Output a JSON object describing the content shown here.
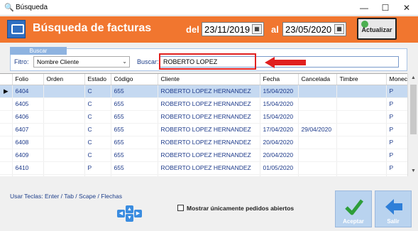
{
  "window": {
    "title": "Búsqueda",
    "controls": [
      "—",
      "☐",
      "✕"
    ]
  },
  "header": {
    "title": "Búsqueda de facturas",
    "del_label": "del",
    "date_from": "23/11/2019",
    "al_label": "al",
    "date_to": "23/05/2020",
    "refresh_label": "Actualizar",
    "accent_color": "#f1762f"
  },
  "search": {
    "group_caption": "Buscar",
    "filtro_label": "Fitro:",
    "filtro_value": "Nombre Cliente",
    "buscar_label": "Buscar:",
    "buscar_value": "ROBERTO LOPEZ"
  },
  "table": {
    "columns": [
      "Folio",
      "Orden",
      "Estado",
      "Código",
      "Cliente",
      "Fecha",
      "Cancelada",
      "Timbre",
      "Monec"
    ],
    "rows": [
      {
        "indicator": "▶",
        "cells": [
          "6404",
          "",
          "C",
          "655",
          "ROBERTO LOPEZ HERNANDEZ",
          "15/04/2020",
          "",
          "",
          "P"
        ]
      },
      {
        "indicator": "",
        "cells": [
          "6405",
          "",
          "C",
          "655",
          "ROBERTO LOPEZ HERNANDEZ",
          "15/04/2020",
          "",
          "",
          "P"
        ]
      },
      {
        "indicator": "",
        "cells": [
          "6406",
          "",
          "C",
          "655",
          "ROBERTO LOPEZ HERNANDEZ",
          "15/04/2020",
          "",
          "",
          "P"
        ]
      },
      {
        "indicator": "",
        "cells": [
          "6407",
          "",
          "C",
          "655",
          "ROBERTO LOPEZ HERNANDEZ",
          "17/04/2020",
          "29/04/2020",
          "",
          "P"
        ]
      },
      {
        "indicator": "",
        "cells": [
          "6408",
          "",
          "C",
          "655",
          "ROBERTO LOPEZ HERNANDEZ",
          "20/04/2020",
          "",
          "",
          "P"
        ]
      },
      {
        "indicator": "",
        "cells": [
          "6409",
          "",
          "C",
          "655",
          "ROBERTO LOPEZ HERNANDEZ",
          "20/04/2020",
          "",
          "",
          "P"
        ]
      },
      {
        "indicator": "",
        "cells": [
          "6410",
          "",
          "P",
          "655",
          "ROBERTO LOPEZ HERNANDEZ",
          "01/05/2020",
          "",
          "",
          "P"
        ]
      },
      {
        "indicator": "",
        "cells": [
          "6411",
          "",
          "C",
          "655",
          "ROBERTO LOPEZ HERNANDEZ",
          "04/05/2020",
          "",
          "CCAC7BDF-7...",
          "P"
        ]
      }
    ]
  },
  "footer": {
    "keys_text": "Usar Teclas:  Enter  /  Tab  /  Scape  /  Flechas",
    "checkbox_label": "Mostrar únicamente pedidos abiertos",
    "accept_label": "Aceptar",
    "exit_label": "Salir"
  }
}
